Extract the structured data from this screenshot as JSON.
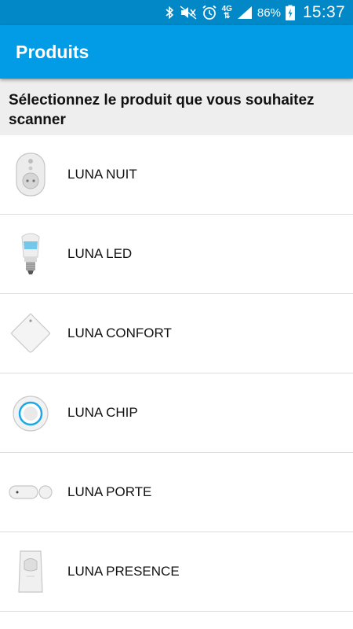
{
  "status_bar": {
    "time": "15:37",
    "battery_percent": "86%",
    "network": "4G",
    "icons": [
      "bluetooth-icon",
      "mute-icon",
      "alarm-icon",
      "network-4g-icon",
      "signal-icon",
      "battery-charging-icon"
    ]
  },
  "app_bar": {
    "title": "Produits"
  },
  "subheader": {
    "text": "Sélectionnez le produit que vous souhaitez scanner"
  },
  "products": [
    {
      "name": "LUNA NUIT",
      "icon": "night-light-plug-icon"
    },
    {
      "name": "LUNA LED",
      "icon": "led-bulb-icon"
    },
    {
      "name": "LUNA CONFORT",
      "icon": "confort-sensor-icon"
    },
    {
      "name": "LUNA CHIP",
      "icon": "chip-button-icon"
    },
    {
      "name": "LUNA PORTE",
      "icon": "door-sensor-icon"
    },
    {
      "name": "LUNA PRESENCE",
      "icon": "presence-sensor-icon"
    }
  ],
  "colors": {
    "status_bar": "#0288c7",
    "app_bar": "#029be5",
    "subheader_bg": "#eeeeee",
    "accent_blue": "#1aa9e6"
  }
}
